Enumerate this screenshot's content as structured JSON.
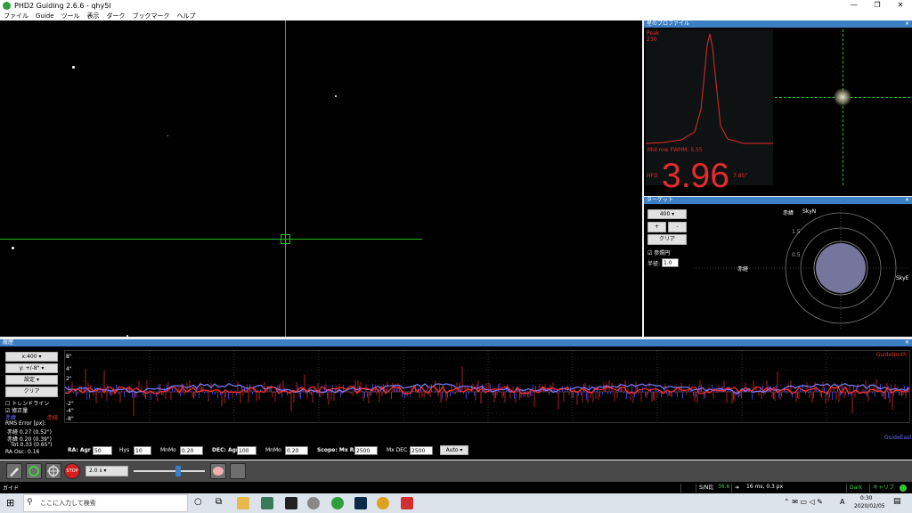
{
  "window": {
    "title": "PHD2 Guiding 2.6.6 - qhy5l",
    "minimize": "—",
    "restore": "❐",
    "close": "✕"
  },
  "menu": [
    "ファイル",
    "Guide",
    "ツール",
    "表示",
    "ダーク",
    "ブックマーク",
    "ヘルプ"
  ],
  "profile": {
    "title": "星のプロファイル",
    "peak_label": "Peak",
    "peak_value": "230",
    "fwhm": "Mid row FWHM: 5.55",
    "hfd_label": "HFD",
    "hfd_value": "3.96",
    "hfd_arcsec": "7.85\""
  },
  "target": {
    "title": "ターゲット",
    "scale": "400",
    "plus": "+",
    "minus": "-",
    "clear": "クリア",
    "checkbox_label": "参照円",
    "radius_label": "半径:",
    "radius_value": "1.0",
    "axis_top": "赤緯",
    "axis_top2": "SkyN",
    "axis_left": "赤経",
    "axis_right": "SkyE",
    "ring_labels": [
      "1.5",
      "0.5"
    ]
  },
  "graph": {
    "title": "履歴",
    "x_scale": "x:400",
    "y_scale": "y: +/-8\"",
    "settings": "設定",
    "clear": "クリア",
    "trend_label": "トレンドライン",
    "correction_label": "修正量",
    "ra_legend": "赤経",
    "dec_legend": "赤緯",
    "rms_title": "RMS Error [px]:",
    "rms_ra": "赤経  0.27 (0.52\")",
    "rms_dec": "赤緯  0.20 (0.39\")",
    "rms_tot": "Tot  0.33 (0.65\")",
    "ra_osc": "RA Osc: 0.16",
    "y_ticks": [
      "8\"",
      "4\"",
      "2\"",
      "-2\"",
      "-4\"",
      "-8\""
    ],
    "guide_north": "GuideNorth",
    "guide_east": "GuideEast"
  },
  "bottom_controls": {
    "ra_label": "RA: Agr",
    "ra_agr": "50",
    "hys_label": "Hys",
    "hys": "10",
    "mnmo_label": "MnMo",
    "ra_mnmo": "0.20",
    "dec_label": "DEC: Agr",
    "dec_agr": "100",
    "dec_mnmo_label": "MnMo",
    "dec_mnmo": "0.20",
    "scope_label": "Scope: Mx RA",
    "mx_ra": "2500",
    "mx_dec_label": "Mx DEC",
    "mx_dec": "2500",
    "mode": "Auto"
  },
  "toolbar": {
    "exposure": "2.0 s",
    "stop": "STOP"
  },
  "status": {
    "mode": "ガイド",
    "snr_label": "S/N比",
    "snr_value": "36.6",
    "pulse": "16 ms, 0.3 px",
    "dark": "Dark",
    "cal": "キャリブ"
  },
  "taskbar": {
    "search": "ここに入力して検索",
    "time": "0:30",
    "date": "2020/02/05",
    "ime": "A"
  },
  "colors": {
    "ra": "#e53030",
    "dec": "#5050ff",
    "crosshair": "#1fbf1f",
    "accent": "#3d7fc4"
  }
}
